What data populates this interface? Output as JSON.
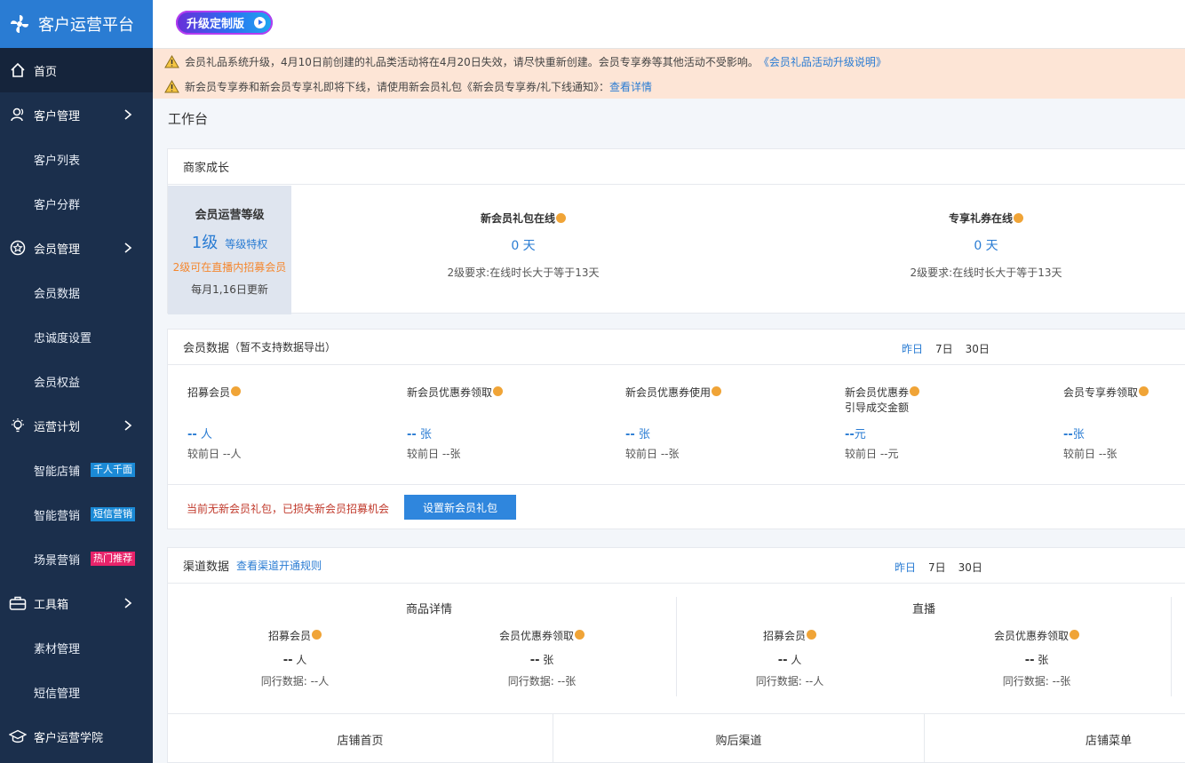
{
  "app": {
    "title": "客户运营平台"
  },
  "upgrade_button": "升级定制版",
  "sidebar": {
    "home": "首页",
    "customer_mgmt": "客户管理",
    "customer_list": "客户列表",
    "customer_group": "客户分群",
    "member_mgmt": "会员管理",
    "member_data": "会员数据",
    "loyalty": "忠诚度设置",
    "member_rights": "会员权益",
    "ops_plan": "运营计划",
    "smart_shop": "智能店铺",
    "smart_shop_tag": "千人千面",
    "smart_marketing": "智能营销",
    "smart_marketing_tag": "短信营销",
    "scene_marketing": "场景营销",
    "scene_marketing_tag": "热门推荐",
    "toolbox": "工具箱",
    "material": "素材管理",
    "sms": "短信管理",
    "academy": "客户运营学院"
  },
  "notices": [
    {
      "text": "会员礼品系统升级，4月10日前创建的礼品类活动将在4月20日失效，请尽快重新创建。会员专享券等其他活动不受影响。",
      "link": "《会员礼品活动升级说明》"
    },
    {
      "text": "新会员专享券和新会员专享礼即将下线，请使用新会员礼包《新会员专享券/礼下线通知》：",
      "link": "查看详情"
    }
  ],
  "page_title": "工作台",
  "growth": {
    "title": "商家成长",
    "level_title": "会员运营等级",
    "level_value": "1级",
    "level_priv": "等级特权",
    "level_hint": "2级可在直播内招募会员",
    "level_update": "每月1,16日更新",
    "items": [
      {
        "title": "新会员礼包在线",
        "value": "0 天",
        "req": "2级要求:在线时长大于等于13天"
      },
      {
        "title": "专享礼券在线",
        "value": "0 天",
        "req": "2级要求:在线时长大于等于13天"
      }
    ]
  },
  "member_data": {
    "title": "会员数据",
    "subtitle": "（暂不支持数据导出）",
    "ranges": [
      "昨日",
      "7日",
      "30日"
    ],
    "metrics": [
      {
        "title": "招募会员",
        "title2": "",
        "value": "--",
        "unit": " 人",
        "compare": "较前日 --人"
      },
      {
        "title": "新会员优惠券领取",
        "title2": "",
        "value": "--",
        "unit": " 张",
        "compare": "较前日 --张"
      },
      {
        "title": "新会员优惠券使用",
        "title2": "",
        "value": "--",
        "unit": " 张",
        "compare": "较前日 --张"
      },
      {
        "title": "新会员优惠券",
        "title2": "引导成交金额",
        "value": "--",
        "unit": "元",
        "compare": "较前日 --元"
      },
      {
        "title": "会员专享券领取",
        "title2": "",
        "value": "--",
        "unit": "张",
        "compare": "较前日 --张"
      }
    ],
    "warning": "当前无新会员礼包，已损失新会员招募机会",
    "button": "设置新会员礼包"
  },
  "channel_data": {
    "title": "渠道数据",
    "link": "查看渠道开通规则",
    "ranges": [
      "昨日",
      "7日",
      "30日"
    ],
    "blocks": [
      {
        "title": "商品详情",
        "subs": [
          {
            "title": "招募会员",
            "value": "--",
            "unit": " 人",
            "peer": "同行数据:  --人"
          },
          {
            "title": "会员优惠券领取",
            "value": "--",
            "unit": " 张",
            "peer": "同行数据:  --张"
          }
        ]
      },
      {
        "title": "直播",
        "subs": [
          {
            "title": "招募会员",
            "value": "--",
            "unit": " 人",
            "peer": "同行数据:  --人"
          },
          {
            "title": "会员优惠券领取",
            "value": "--",
            "unit": " 张",
            "peer": "同行数据:  --张"
          }
        ]
      }
    ],
    "bottom": [
      "店铺首页",
      "购后渠道",
      "店铺菜单"
    ]
  }
}
